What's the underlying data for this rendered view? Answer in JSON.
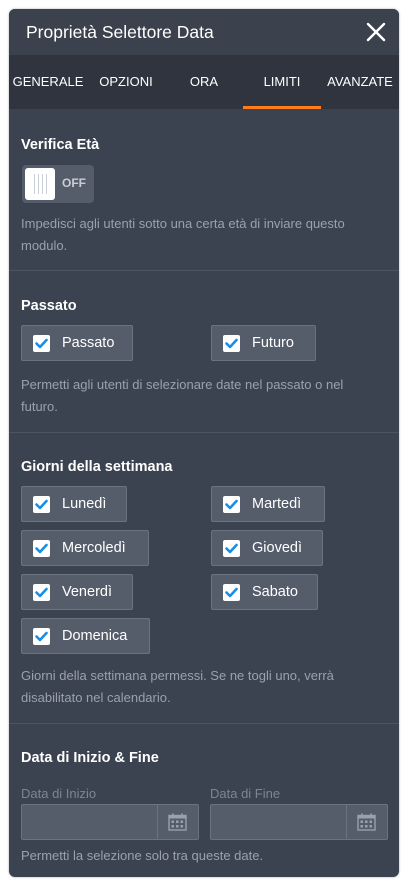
{
  "header": {
    "title": "Proprietà Selettore Data"
  },
  "tabs": [
    {
      "label": "GENERALE"
    },
    {
      "label": "OPZIONI"
    },
    {
      "label": "ORA"
    },
    {
      "label": "LIMITI"
    },
    {
      "label": "AVANZATE"
    }
  ],
  "age_check": {
    "title": "Verifica Età",
    "toggle_state": "OFF",
    "description": "Impedisci agli utenti sotto una certa età di inviare questo modulo."
  },
  "past": {
    "title": "Passato",
    "options": [
      {
        "label": "Passato",
        "checked": true
      },
      {
        "label": "Futuro",
        "checked": true
      }
    ],
    "description": "Permetti agli utenti di selezionare date nel passato o nel futuro."
  },
  "weekdays": {
    "title": "Giorni della settimana",
    "days": [
      {
        "label": "Lunedì",
        "checked": true
      },
      {
        "label": "Martedì",
        "checked": true
      },
      {
        "label": "Mercoledì",
        "checked": true
      },
      {
        "label": "Giovedì",
        "checked": true
      },
      {
        "label": "Venerdì",
        "checked": true
      },
      {
        "label": "Sabato",
        "checked": true
      },
      {
        "label": "Domenica",
        "checked": true
      }
    ],
    "description": "Giorni della settimana permessi. Se ne togli uno, verrà disabilitato nel calendario."
  },
  "date_range": {
    "title": "Data di Inizio & Fine",
    "start_label": "Data di Inizio",
    "end_label": "Data di Fine",
    "start_value": "",
    "end_value": "",
    "description": "Permetti la selezione solo tra queste date."
  },
  "colors": {
    "panel": "#3c4350",
    "tab_bar": "#2f343f",
    "accent": "#ff7b1c",
    "checkbox_tick": "#1a8ee6"
  },
  "icons": {
    "close": "close-icon",
    "check": "checkmark-icon",
    "calendar": "calendar-icon"
  }
}
